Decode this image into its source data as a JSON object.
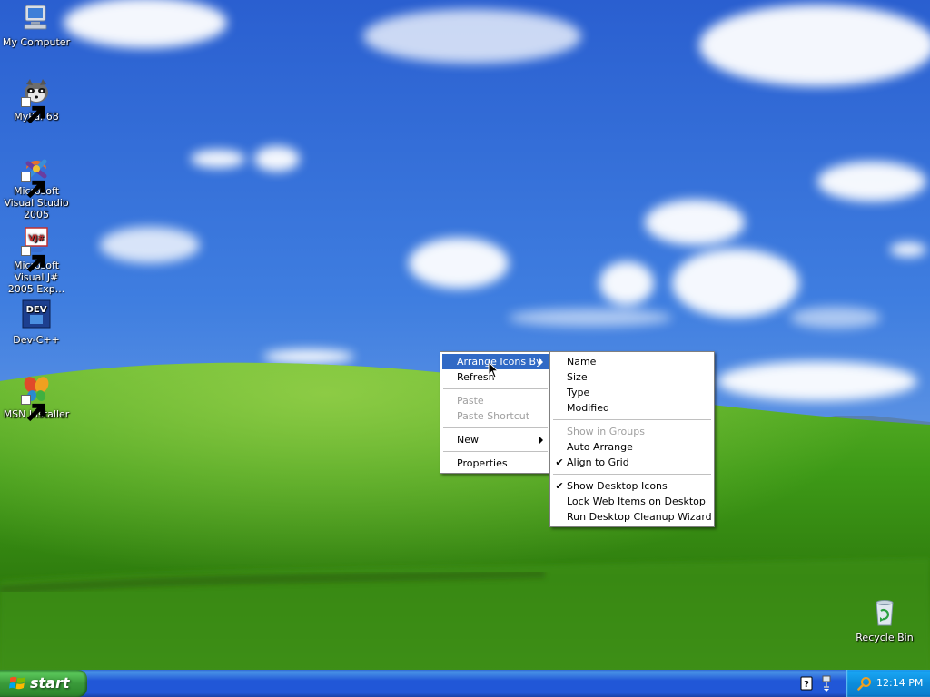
{
  "desktop": {
    "icons": [
      {
        "label": "My Computer"
      },
      {
        "label": "MyPal 68"
      },
      {
        "label": "Microsoft Visual Studio 2005"
      },
      {
        "label": "Microsoft Visual J# 2005 Exp..."
      },
      {
        "label": "Dev-C++"
      },
      {
        "label": "MSN Installer"
      },
      {
        "label": "Recycle Bin"
      }
    ],
    "icon_glyphs": {
      "devcpp_badge": "DEV",
      "vj_badge": "VJ#"
    }
  },
  "context_menu": {
    "items": [
      {
        "label": "Arrange Icons By",
        "state": "highlighted",
        "submenu": true
      },
      {
        "label": "Refresh"
      },
      {
        "label": "Paste",
        "state": "disabled"
      },
      {
        "label": "Paste Shortcut",
        "state": "disabled"
      },
      {
        "label": "New",
        "submenu": true
      },
      {
        "label": "Properties"
      }
    ]
  },
  "submenu": {
    "items": [
      {
        "label": "Name"
      },
      {
        "label": "Size"
      },
      {
        "label": "Type"
      },
      {
        "label": "Modified"
      },
      {
        "label": "Show in Groups",
        "state": "disabled"
      },
      {
        "label": "Auto Arrange"
      },
      {
        "label": "Align to Grid",
        "checked": true
      },
      {
        "label": "Show Desktop Icons",
        "checked": true
      },
      {
        "label": "Lock Web Items on Desktop"
      },
      {
        "label": "Run Desktop Cleanup Wizard"
      }
    ],
    "check_glyph": "✔"
  },
  "taskbar": {
    "start_label": "start",
    "clock": "12:14 PM"
  },
  "colors": {
    "menu_highlight": "#316ac5",
    "taskbar_blue": "#2157d7",
    "start_green": "#3a9a3a",
    "tray_blue": "#0d8ddb"
  }
}
